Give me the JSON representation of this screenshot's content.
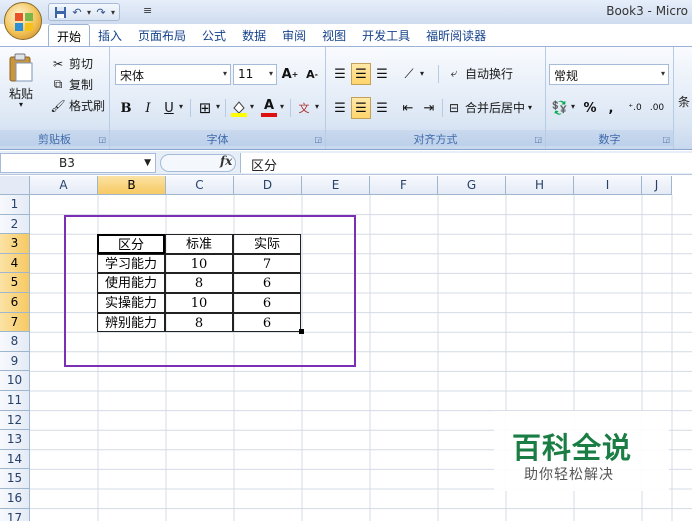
{
  "app": {
    "title": "Book3 - Micro"
  },
  "tabs": [
    "开始",
    "插入",
    "页面布局",
    "公式",
    "数据",
    "审阅",
    "视图",
    "开发工具",
    "福昕阅读器"
  ],
  "ribbon": {
    "clipboard": {
      "label": "剪贴板",
      "paste": "粘贴",
      "cut": "剪切",
      "copy": "复制",
      "format_painter": "格式刷"
    },
    "font": {
      "label": "字体",
      "name": "宋体",
      "size": "11",
      "bold": "B",
      "italic": "I",
      "underline": "U"
    },
    "alignment": {
      "label": "对齐方式",
      "wrap": "自动换行",
      "merge": "合并后居中"
    },
    "number": {
      "label": "数字",
      "format": "常规",
      "percent": "%",
      "comma": ","
    },
    "styles": {
      "partial_label": "条"
    }
  },
  "formula_bar": {
    "name_box": "B3",
    "fx": "fx",
    "content": "区分"
  },
  "columns": [
    "A",
    "B",
    "C",
    "D",
    "E",
    "F",
    "G",
    "H",
    "I",
    "J"
  ],
  "rows": [
    "1",
    "2",
    "3",
    "4",
    "5",
    "6",
    "7",
    "8",
    "9",
    "10",
    "11",
    "12",
    "13",
    "14",
    "15",
    "16",
    "17"
  ],
  "table": {
    "headers": [
      "区分",
      "标准",
      "实际"
    ],
    "rows": [
      [
        "学习能力",
        "10",
        "7"
      ],
      [
        "使用能力",
        "8",
        "6"
      ],
      [
        "实操能力",
        "10",
        "6"
      ],
      [
        "辨别能力",
        "8",
        "6"
      ]
    ]
  },
  "watermark": {
    "title": "百科全说",
    "subtitle": "助你轻松解决"
  },
  "colors": {
    "annotation": "#7b2fb5",
    "watermark": "#1a7e44",
    "selected_header": "#f7c962"
  }
}
